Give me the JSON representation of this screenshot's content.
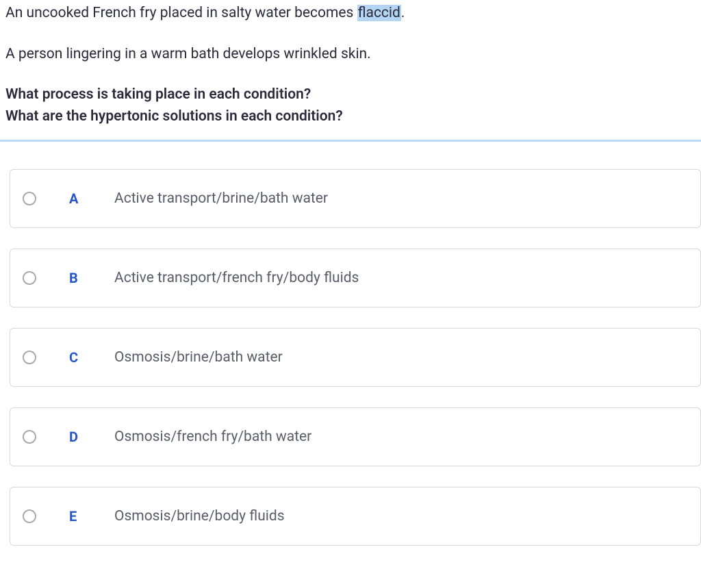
{
  "question": {
    "line1_prefix": "An uncooked French fry placed in salty water becomes ",
    "line1_highlight": "flaccid",
    "line1_suffix": ".",
    "line2": "A person lingering in a warm bath develops wrinkled skin.",
    "line3": "What process is taking place in each condition?",
    "line4": "What are the hypertonic solutions in each condition?"
  },
  "options": [
    {
      "letter": "A",
      "text": "Active transport/brine/bath water"
    },
    {
      "letter": "B",
      "text": "Active transport/french fry/body fluids"
    },
    {
      "letter": "C",
      "text": "Osmosis/brine/bath water"
    },
    {
      "letter": "D",
      "text": "Osmosis/french fry/bath water"
    },
    {
      "letter": "E",
      "text": "Osmosis/brine/body fluids"
    }
  ]
}
